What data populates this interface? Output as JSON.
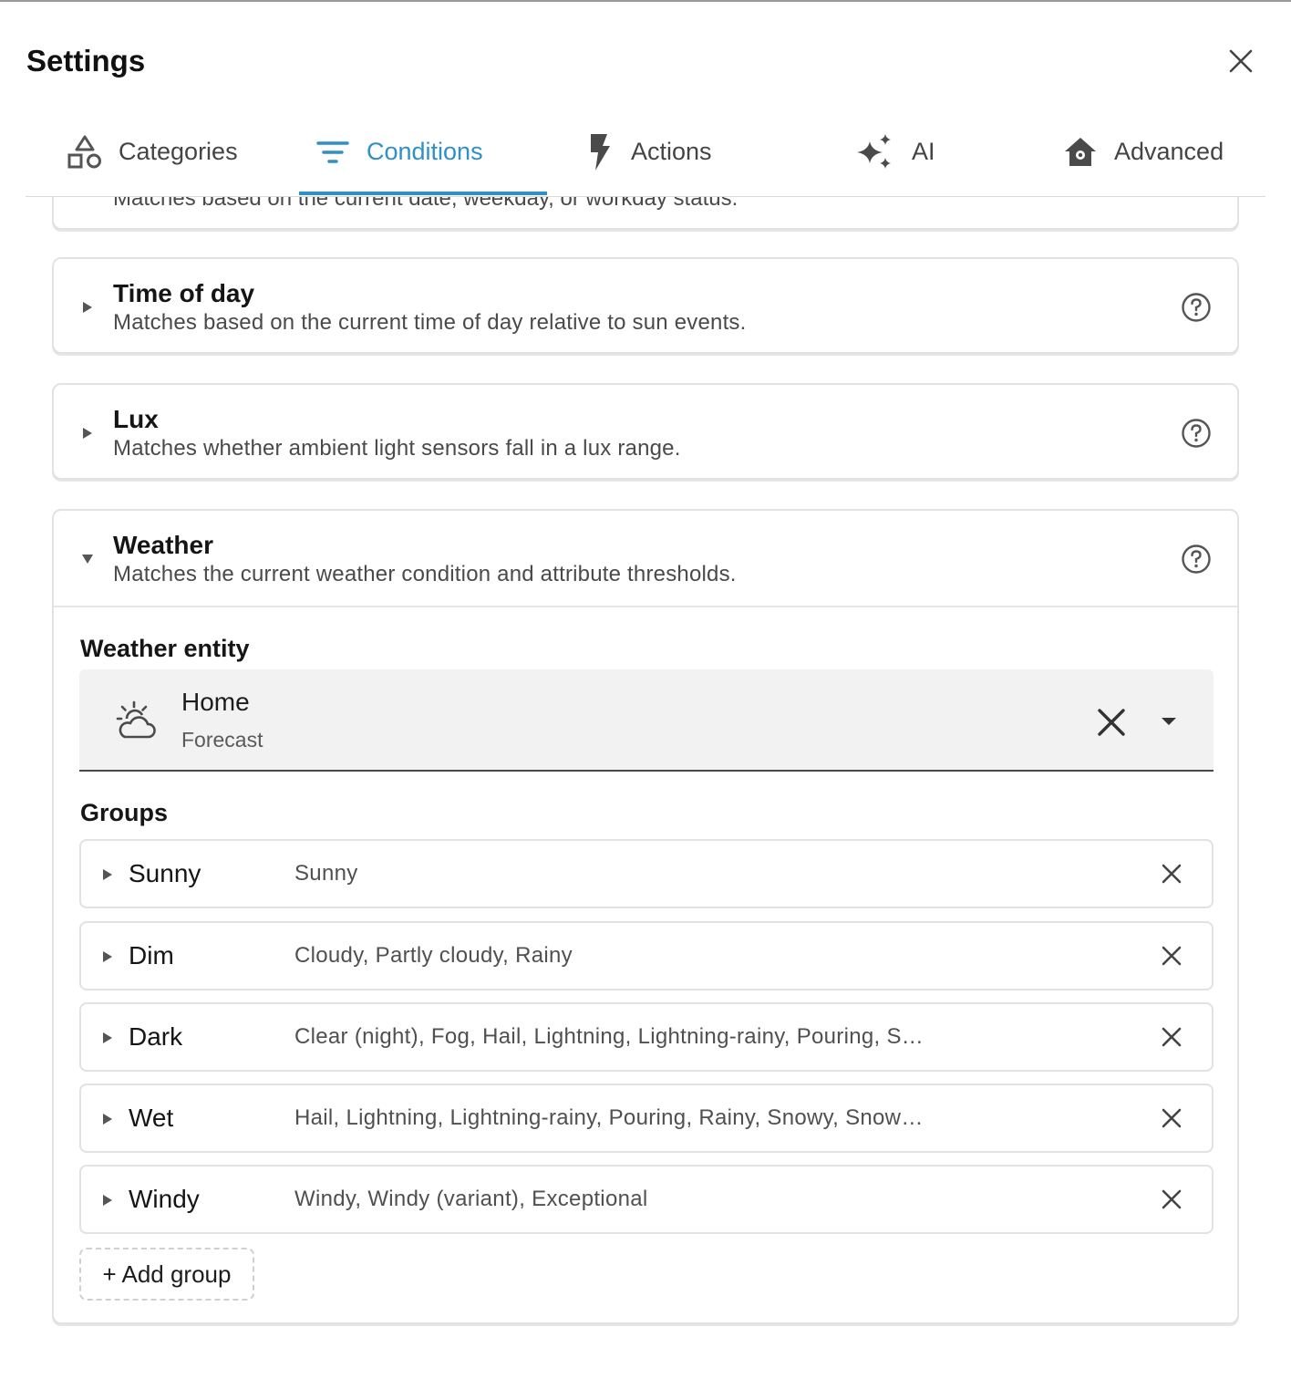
{
  "dialog": {
    "title": "Settings"
  },
  "tabs": [
    {
      "label": "Categories",
      "icon": "shapes-icon"
    },
    {
      "label": "Conditions",
      "icon": "filter-icon",
      "active": true
    },
    {
      "label": "Actions",
      "icon": "lightning-icon"
    },
    {
      "label": "AI",
      "icon": "sparkles-icon"
    },
    {
      "label": "Advanced",
      "icon": "home-gear-icon"
    }
  ],
  "colors": {
    "accent": "#2f8fc7",
    "text": "#1b1b1b",
    "muted": "#4a4a4a",
    "border": "#e2e2e2",
    "field_bg": "#f2f2f2"
  },
  "conditions": {
    "date_card": {
      "description": "Matches based on the current date, weekday, or workday status."
    },
    "time_of_day": {
      "title": "Time of day",
      "description": "Matches based on the current time of day relative to sun events."
    },
    "lux": {
      "title": "Lux",
      "description": "Matches whether ambient light sensors fall in a lux range."
    },
    "weather": {
      "title": "Weather",
      "description": "Matches the current weather condition and attribute thresholds.",
      "entity_label": "Weather entity",
      "entity": {
        "name": "Home",
        "subtitle": "Forecast",
        "icon": "weather-partly-cloudy-icon"
      },
      "groups_label": "Groups",
      "groups": [
        {
          "name": "Sunny",
          "values": "Sunny"
        },
        {
          "name": "Dim",
          "values": "Cloudy, Partly cloudy, Rainy"
        },
        {
          "name": "Dark",
          "values": "Clear (night), Fog, Hail, Lightning, Lightning-rainy, Pouring, Snowy, Snowy-rainy"
        },
        {
          "name": "Wet",
          "values": "Hail, Lightning, Lightning-rainy, Pouring, Rainy, Snowy, Snowy-rainy"
        },
        {
          "name": "Windy",
          "values": "Windy, Windy (variant), Exceptional"
        }
      ],
      "add_group_label": "+ Add group"
    }
  }
}
